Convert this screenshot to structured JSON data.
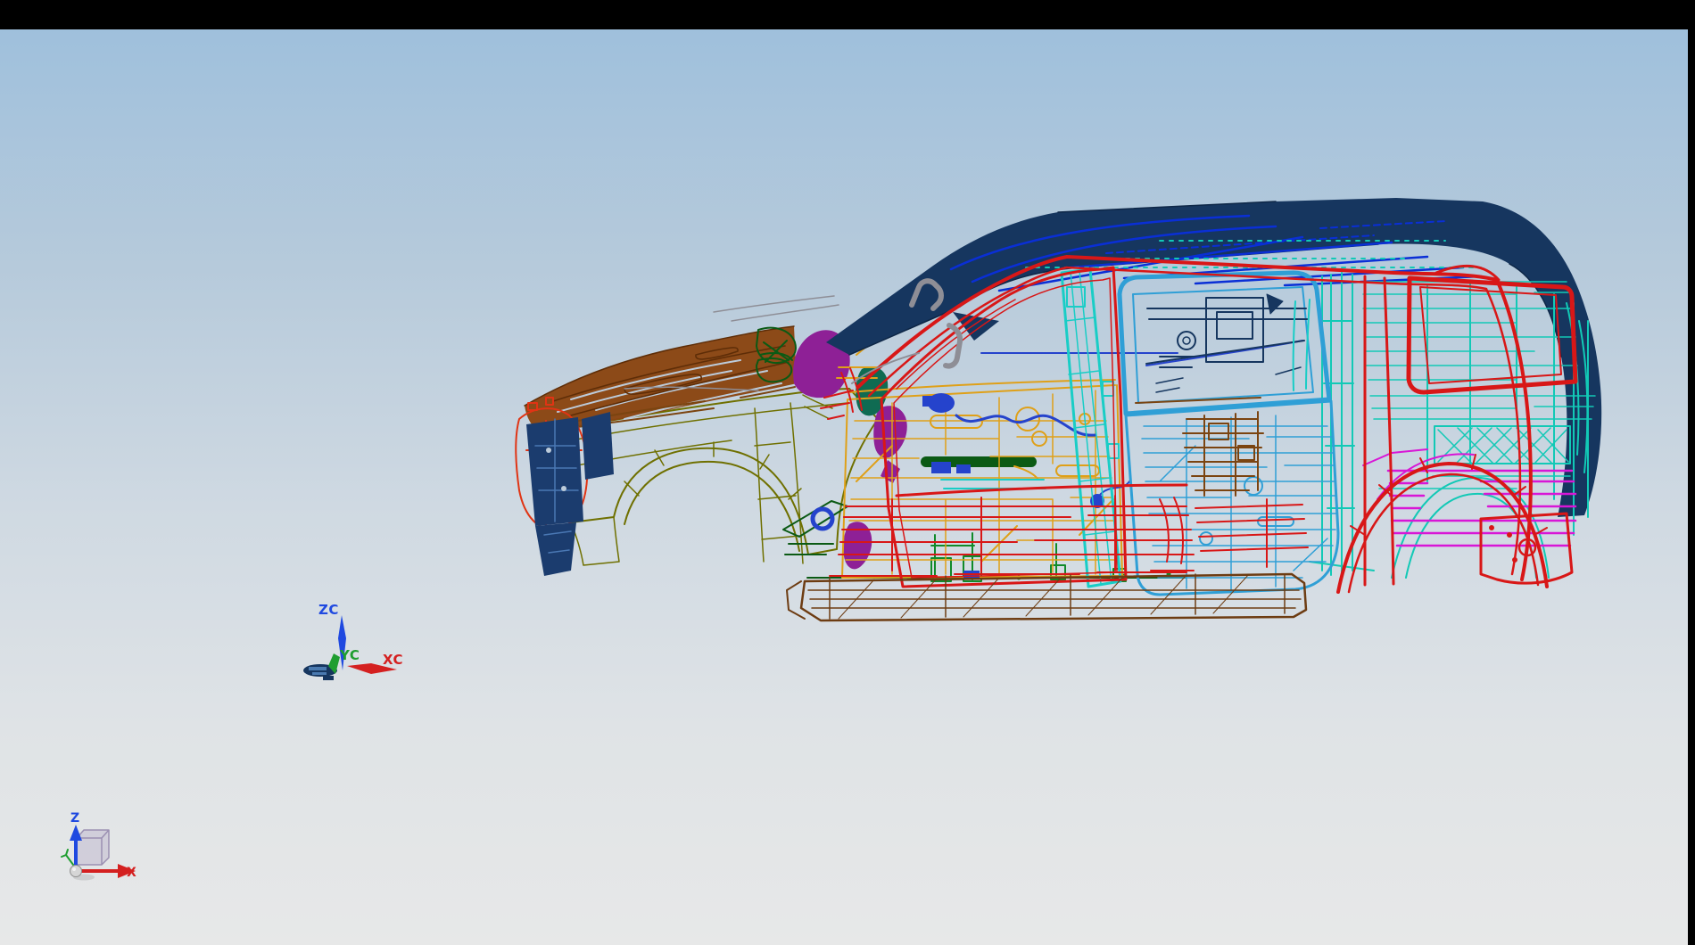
{
  "window": {
    "top_bar": "black",
    "right_bar": "black"
  },
  "viewport": {
    "kind": "cad-graphics-view"
  },
  "wcs_triad": {
    "z_label": "ZC",
    "y_label": "YC",
    "x_label": "XC"
  },
  "view_triad": {
    "z_label": "Z",
    "x_label": "X"
  },
  "colors": {
    "chrome": "#000000",
    "bg_top": "#9fc0dc",
    "bg_upper": "#b6cadb",
    "bg_mid": "#cfd9e2",
    "bg_lower": "#dfe3e6",
    "bg_bottom": "#e7e8e8",
    "sky_streak": "#bccbda",
    "hood": "#8a4512",
    "hood_edge": "#5e2d07",
    "fender": "#6f7000",
    "headlamp": "#e03414",
    "front_lower": "#1b3c6e",
    "front_lower_line": "#4a78b4",
    "cowl_purple": "#8e2096",
    "door_gold": "#dfa018",
    "hw_blue": "#2543cc",
    "roof_navy": "#16365f",
    "roof_navy_dark": "#0e2747",
    "roof_blue": "#0a2fd6",
    "frame_red": "#d81717",
    "bpillar_cyan": "#19cdc6",
    "door_blue": "#2f9fd6",
    "quarter_teal": "#12c9b6",
    "magenta": "#d816d6",
    "rocker_brown": "#6d3c12",
    "brown_detail": "#7b4410",
    "green_dark": "#0b5a14",
    "green_teal": "#0f6b52",
    "green_mid": "#118a2a",
    "gray_part": "#8e8e96",
    "axis_blue": "#1f49e0",
    "axis_green": "#1f9e30",
    "axis_red": "#d42020",
    "cube_edge": "#9b90b2",
    "cube_fill": "rgba(190,182,205,0.5)",
    "sphere_fill": "#d6d6d6",
    "sphere_edge": "#8f8f8f",
    "disc_slot": "#4a7ab0"
  },
  "model": {
    "label": "vehicle-body-wireframe",
    "parts": [
      {
        "name": "hood",
        "color_key": "hood"
      },
      {
        "name": "front-fender",
        "color_key": "fender"
      },
      {
        "name": "headlamp-bracket",
        "color_key": "headlamp"
      },
      {
        "name": "front-lower-panel",
        "color_key": "front_lower"
      },
      {
        "name": "cowl-brackets",
        "color_key": "cowl_purple"
      },
      {
        "name": "front-door-inner",
        "color_key": "door_gold"
      },
      {
        "name": "door-hardware",
        "color_key": "hw_blue"
      },
      {
        "name": "roof-frame",
        "color_key": "roof_navy"
      },
      {
        "name": "roof-bows",
        "color_key": "roof_blue"
      },
      {
        "name": "pillar-frames",
        "color_key": "frame_red"
      },
      {
        "name": "b-pillar",
        "color_key": "bpillar_cyan"
      },
      {
        "name": "rear-door",
        "color_key": "door_blue"
      },
      {
        "name": "quarter-panel-inner",
        "color_key": "quarter_teal"
      },
      {
        "name": "rear-fender",
        "color_key": "magenta"
      },
      {
        "name": "rocker-sill",
        "color_key": "rocker_brown"
      },
      {
        "name": "floor-brackets",
        "color_key": "green_mid"
      },
      {
        "name": "grab-handles",
        "color_key": "gray_part"
      }
    ]
  }
}
